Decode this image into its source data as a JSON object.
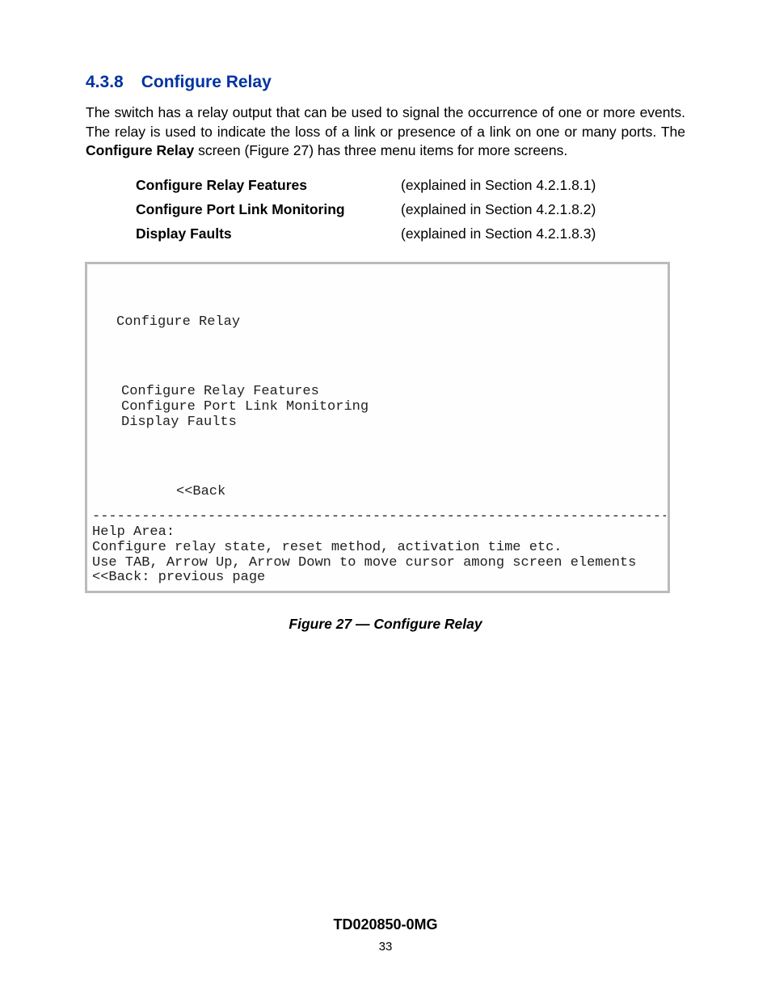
{
  "heading": {
    "number": "4.3.8",
    "title": "Configure Relay"
  },
  "paragraph": {
    "prefix": "The switch has a relay output that can be used to signal the occurrence of one or more events.  The relay is used to indicate the loss of a link or presence of a link on one or many ports.  The ",
    "bold": "Configure Relay",
    "suffix": " screen (Figure 27) has three menu items for more screens."
  },
  "features": [
    {
      "name": "Configure Relay Features",
      "ref": "(explained in Section 4.2.1.8.1)"
    },
    {
      "name": "Configure Port Link Monitoring",
      "ref": "(explained in Section 4.2.1.8.2)"
    },
    {
      "name": "Display Faults",
      "ref": "(explained in Section 4.2.1.8.3)"
    }
  ],
  "terminal": {
    "title": "Configure Relay",
    "items": [
      "Configure Relay Features",
      "Configure Port Link Monitoring",
      "Display Faults"
    ],
    "back": "<<Back",
    "hr": "--------------------------------------------------------------------------------",
    "help_lines": [
      "Help Area:",
      "Configure relay state, reset method, activation time etc.",
      "Use TAB, Arrow Up, Arrow Down to move cursor among screen elements",
      "<<Back: previous page"
    ]
  },
  "figure_caption": "Figure 27 — Configure Relay",
  "footer": {
    "docid": "TD020850-0MG",
    "page": "33"
  }
}
